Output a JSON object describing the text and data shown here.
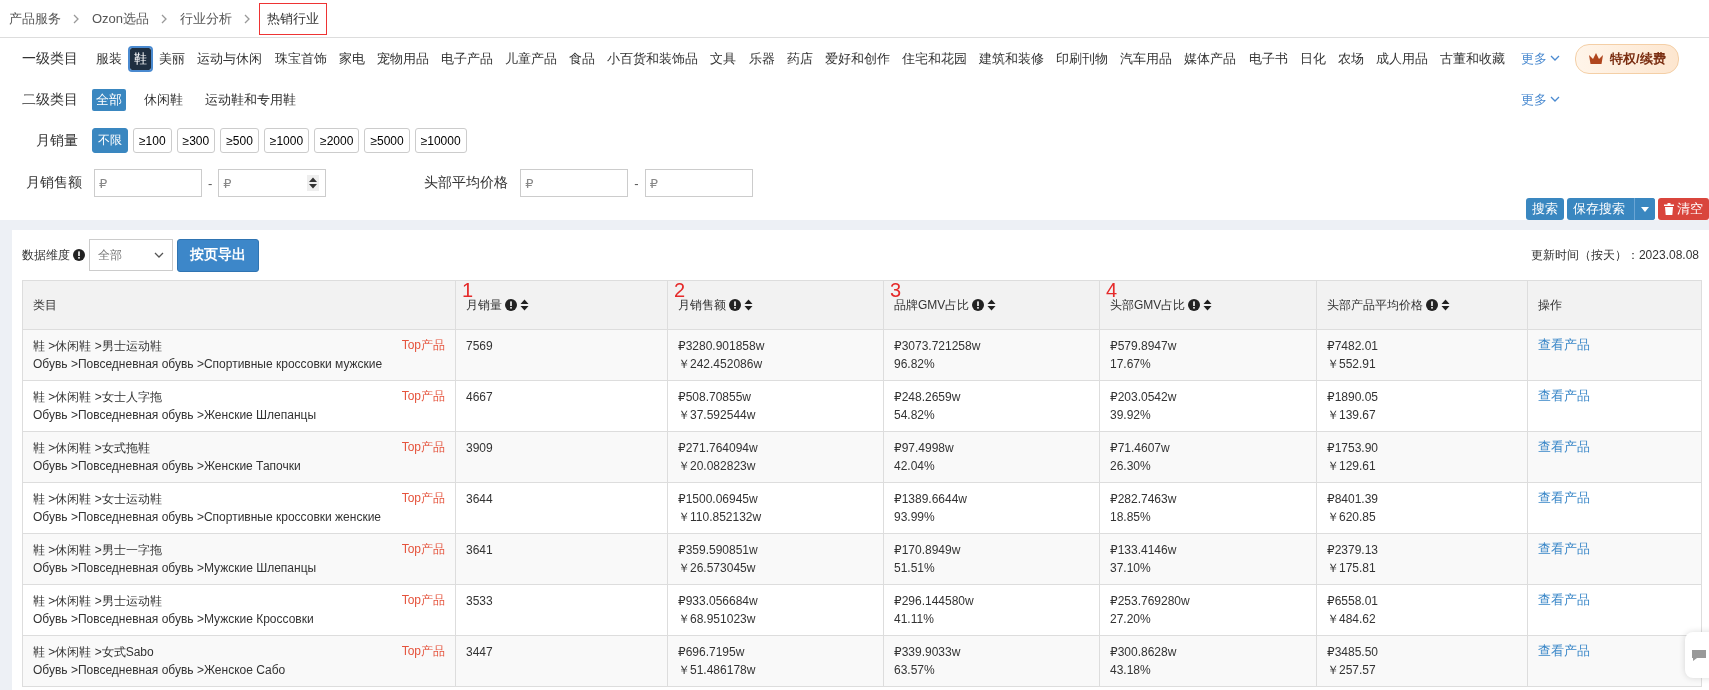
{
  "breadcrumb": [
    {
      "label": "产品服务",
      "current": false
    },
    {
      "label": "Ozon选品",
      "current": false
    },
    {
      "label": "行业分析",
      "current": false
    },
    {
      "label": "热销行业",
      "current": true
    }
  ],
  "filters": {
    "level1": {
      "label": "一级类目",
      "more": "更多",
      "items": [
        {
          "label": "服装",
          "selected": false
        },
        {
          "label": "鞋",
          "selected": true
        },
        {
          "label": "美丽",
          "selected": false
        },
        {
          "label": "运动与休闲",
          "selected": false
        },
        {
          "label": "珠宝首饰",
          "selected": false
        },
        {
          "label": "家电",
          "selected": false
        },
        {
          "label": "宠物用品",
          "selected": false
        },
        {
          "label": "电子产品",
          "selected": false
        },
        {
          "label": "儿童产品",
          "selected": false
        },
        {
          "label": "食品",
          "selected": false
        },
        {
          "label": "小百货和装饰品",
          "selected": false
        },
        {
          "label": "文具",
          "selected": false
        },
        {
          "label": "乐器",
          "selected": false
        },
        {
          "label": "药店",
          "selected": false
        },
        {
          "label": "爱好和创作",
          "selected": false
        },
        {
          "label": "住宅和花园",
          "selected": false
        },
        {
          "label": "建筑和装修",
          "selected": false
        },
        {
          "label": "印刷刊物",
          "selected": false
        },
        {
          "label": "汽车用品",
          "selected": false
        },
        {
          "label": "媒体产品",
          "selected": false
        },
        {
          "label": "电子书",
          "selected": false
        },
        {
          "label": "日化",
          "selected": false
        },
        {
          "label": "农场",
          "selected": false
        },
        {
          "label": "成人用品",
          "selected": false
        },
        {
          "label": "古董和收藏",
          "selected": false
        }
      ]
    },
    "level2": {
      "label": "二级类目",
      "more": "更多",
      "items": [
        {
          "label": "全部",
          "selected": true
        },
        {
          "label": "休闲鞋",
          "selected": false
        },
        {
          "label": "运动鞋和专用鞋",
          "selected": false
        }
      ]
    },
    "monthly_sales": {
      "label": "月销量",
      "options": [
        {
          "label": "不限",
          "selected": true
        },
        {
          "label": "≥100",
          "selected": false
        },
        {
          "label": "≥300",
          "selected": false
        },
        {
          "label": "≥500",
          "selected": false
        },
        {
          "label": "≥1000",
          "selected": false
        },
        {
          "label": "≥2000",
          "selected": false
        },
        {
          "label": "≥5000",
          "selected": false
        },
        {
          "label": "≥10000",
          "selected": false
        }
      ]
    },
    "ranges": [
      {
        "label": "月销售额",
        "separator": "-",
        "fields": [
          {
            "placeholder": "₽",
            "stepper": false
          },
          {
            "placeholder": "₽",
            "stepper": true
          }
        ]
      },
      {
        "label": "头部平均价格",
        "separator": "-",
        "fields": [
          {
            "placeholder": "₽",
            "stepper": false
          },
          {
            "placeholder": "₽",
            "stepper": false
          }
        ]
      }
    ]
  },
  "premium_button": "特权/续费",
  "actions": [
    {
      "label": "搜索",
      "kind": "primary"
    },
    {
      "label": "保存搜索",
      "kind": "split"
    },
    {
      "label": "清空",
      "kind": "danger"
    }
  ],
  "toolbar": {
    "dimension_label": "数据维度",
    "dimension_value": "全部",
    "export_button": "按页导出",
    "updated": "更新时间（按天）：2023.08.08"
  },
  "table": {
    "columns": [
      {
        "label": "类目",
        "info": false,
        "sortable": false
      },
      {
        "label": "月销量",
        "info": true,
        "sortable": true,
        "annotation": "1"
      },
      {
        "label": "月销售额",
        "info": true,
        "sortable": true,
        "annotation": "2"
      },
      {
        "label": "品牌GMV占比",
        "info": true,
        "sortable": true,
        "annotation": "3"
      },
      {
        "label": "头部GMV占比",
        "info": true,
        "sortable": true,
        "annotation": "4"
      },
      {
        "label": "头部产品平均价格",
        "info": true,
        "sortable": true
      },
      {
        "label": "操作",
        "info": false,
        "sortable": false
      }
    ],
    "rows": [
      {
        "category": "鞋 >休闲鞋 >男士运动鞋",
        "category_ru": "Обувь >Повседневная обувь >Спортивные кроссовки мужские",
        "tag": "Top产品",
        "sales": "7569",
        "revenue_rub": "₽3280.901858w",
        "revenue_cny": "￥242.452086w",
        "brand_gmv": "₽3073.721258w",
        "brand_share": "96.82%",
        "top_gmv": "₽579.8947w",
        "top_share": "17.67%",
        "avg_rub": "₽7482.01",
        "avg_cny": "￥552.91",
        "action": "查看产品"
      },
      {
        "category": "鞋 >休闲鞋 >女士人字拖",
        "category_ru": "Обувь >Повседневная обувь >Женские Шлепанцы",
        "tag": "Top产品",
        "sales": "4667",
        "revenue_rub": "₽508.70855w",
        "revenue_cny": "￥37.592544w",
        "brand_gmv": "₽248.2659w",
        "brand_share": "54.82%",
        "top_gmv": "₽203.0542w",
        "top_share": "39.92%",
        "avg_rub": "₽1890.05",
        "avg_cny": "￥139.67",
        "action": "查看产品"
      },
      {
        "category": "鞋 >休闲鞋 >女式拖鞋",
        "category_ru": "Обувь >Повседневная обувь >Женские Тапочки",
        "tag": "Top产品",
        "sales": "3909",
        "revenue_rub": "₽271.764094w",
        "revenue_cny": "￥20.082823w",
        "brand_gmv": "₽97.4998w",
        "brand_share": "42.04%",
        "top_gmv": "₽71.4607w",
        "top_share": "26.30%",
        "avg_rub": "₽1753.90",
        "avg_cny": "￥129.61",
        "action": "查看产品"
      },
      {
        "category": "鞋 >休闲鞋 >女士运动鞋",
        "category_ru": "Обувь >Повседневная обувь >Спортивные кроссовки женские",
        "tag": "Top产品",
        "sales": "3644",
        "revenue_rub": "₽1500.06945w",
        "revenue_cny": "￥110.852132w",
        "brand_gmv": "₽1389.6644w",
        "brand_share": "93.99%",
        "top_gmv": "₽282.7463w",
        "top_share": "18.85%",
        "avg_rub": "₽8401.39",
        "avg_cny": "￥620.85",
        "action": "查看产品"
      },
      {
        "category": "鞋 >休闲鞋 >男士一字拖",
        "category_ru": "Обувь >Повседневная обувь >Мужские Шлепанцы",
        "tag": "Top产品",
        "sales": "3641",
        "revenue_rub": "₽359.590851w",
        "revenue_cny": "￥26.573045w",
        "brand_gmv": "₽170.8949w",
        "brand_share": "51.51%",
        "top_gmv": "₽133.4146w",
        "top_share": "37.10%",
        "avg_rub": "₽2379.13",
        "avg_cny": "￥175.81",
        "action": "查看产品"
      },
      {
        "category": "鞋 >休闲鞋 >男士运动鞋",
        "category_ru": "Обувь >Повседневная обувь >Мужские Кроссовки",
        "tag": "Top产品",
        "sales": "3533",
        "revenue_rub": "₽933.056684w",
        "revenue_cny": "￥68.951023w",
        "brand_gmv": "₽296.144580w",
        "brand_share": "41.11%",
        "top_gmv": "₽253.769280w",
        "top_share": "27.20%",
        "avg_rub": "₽6558.01",
        "avg_cny": "￥484.62",
        "action": "查看产品"
      },
      {
        "category": "鞋 >休闲鞋 >女式Sabo",
        "category_ru": "Обувь >Повседневная обувь >Женское Сабо",
        "tag": "Top产品",
        "sales": "3447",
        "revenue_rub": "₽696.7195w",
        "revenue_cny": "￥51.486178w",
        "brand_gmv": "₽339.9033w",
        "brand_share": "63.57%",
        "top_gmv": "₽300.8628w",
        "top_share": "43.18%",
        "avg_rub": "₽3485.50",
        "avg_cny": "￥257.57",
        "action": "查看产品"
      }
    ]
  }
}
